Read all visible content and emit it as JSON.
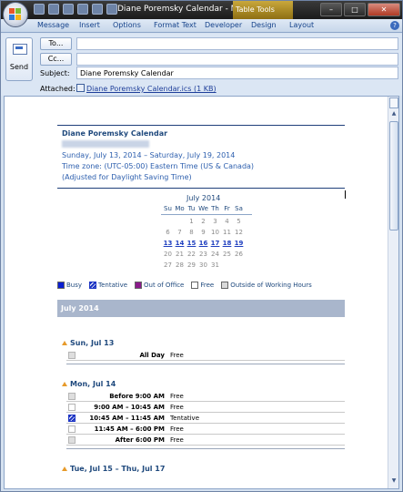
{
  "window": {
    "title": "Diane Poremsky Calendar - Message (...",
    "context_tab": "Table Tools",
    "minimize": "–",
    "maximize": "□",
    "close": "✕"
  },
  "ribbon": {
    "tabs": [
      "Message",
      "Insert",
      "Options",
      "Format Text",
      "Developer",
      "Design",
      "Layout"
    ],
    "help": "?"
  },
  "header": {
    "send_label": "Send",
    "to_button": "To...",
    "cc_button": "Cc...",
    "to_value": "",
    "cc_value": "",
    "subject_label": "Subject:",
    "subject_value": "Diane Poremsky Calendar",
    "attached_label": "Attached:",
    "attachment": "Diane Poremsky Calendar.ics (1 KB)"
  },
  "calendar": {
    "name": "Diane Poremsky Calendar",
    "date_range": "Sunday, July 13, 2014 – Saturday, July 19, 2014",
    "time_zone": "Time zone: (UTC-05:00) Eastern Time (US & Canada)",
    "dst_note": "(Adjusted for Daylight Saving Time)"
  },
  "mini_month": {
    "title": "July 2014",
    "weekdays": [
      "Su",
      "Mo",
      "Tu",
      "We",
      "Th",
      "Fr",
      "Sa"
    ],
    "weeks": [
      [
        "",
        "",
        "1",
        "2",
        "3",
        "4",
        "5"
      ],
      [
        "6",
        "7",
        "8",
        "9",
        "10",
        "11",
        "12"
      ],
      [
        "13",
        "14",
        "15",
        "16",
        "17",
        "18",
        "19"
      ],
      [
        "20",
        "21",
        "22",
        "23",
        "24",
        "25",
        "26"
      ],
      [
        "27",
        "28",
        "29",
        "30",
        "31",
        "",
        ""
      ]
    ],
    "highlighted_week": 2
  },
  "legend": [
    {
      "label": "Busy",
      "color": "#0a1fd1"
    },
    {
      "label": "Tentative",
      "color": "tentative"
    },
    {
      "label": "Out of Office",
      "color": "#8b1a8b"
    },
    {
      "label": "Free",
      "color": "#ffffff"
    },
    {
      "label": "Outside of Working Hours",
      "color": "#d9d9d9"
    }
  ],
  "month_band": "July 2014",
  "days": [
    {
      "label": "Sun, Jul 13",
      "rows": [
        {
          "time": "All Day",
          "status": "Free",
          "box": "grey"
        }
      ]
    },
    {
      "label": "Mon, Jul 14",
      "rows": [
        {
          "time": "Before 9:00 AM",
          "status": "Free",
          "box": "grey"
        },
        {
          "time": "9:00 AM – 10:45 AM",
          "status": "Free",
          "box": "free"
        },
        {
          "time": "10:45 AM – 11:45 AM",
          "status": "Tentative",
          "box": "tent"
        },
        {
          "time": "11:45 AM – 6:00 PM",
          "status": "Free",
          "box": "free"
        },
        {
          "time": "After 6:00 PM",
          "status": "Free",
          "box": "grey"
        }
      ]
    },
    {
      "label": "Tue, Jul 15 – Thu, Jul 17",
      "rows": []
    }
  ]
}
